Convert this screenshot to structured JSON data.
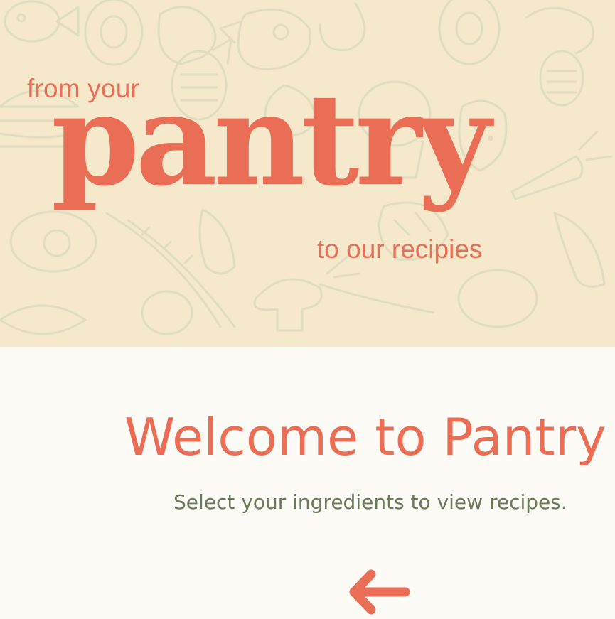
{
  "hero": {
    "tagline_top": "from your",
    "brand_wordmark": "pantry",
    "tagline_bottom": "to our recipies"
  },
  "welcome": {
    "title": "Welcome to Pantry",
    "subtitle": "Select your ingredients to view recipes."
  },
  "icons": {
    "back": "arrow-left-icon",
    "background_pattern": "food-doodle-pattern"
  },
  "colors": {
    "accent": "#ea6e55",
    "hero_background": "#f6e8cb",
    "doodle_stroke": "#e0dcc0",
    "page_background": "#fdfbf5",
    "subtitle_text": "#6a7a58"
  }
}
